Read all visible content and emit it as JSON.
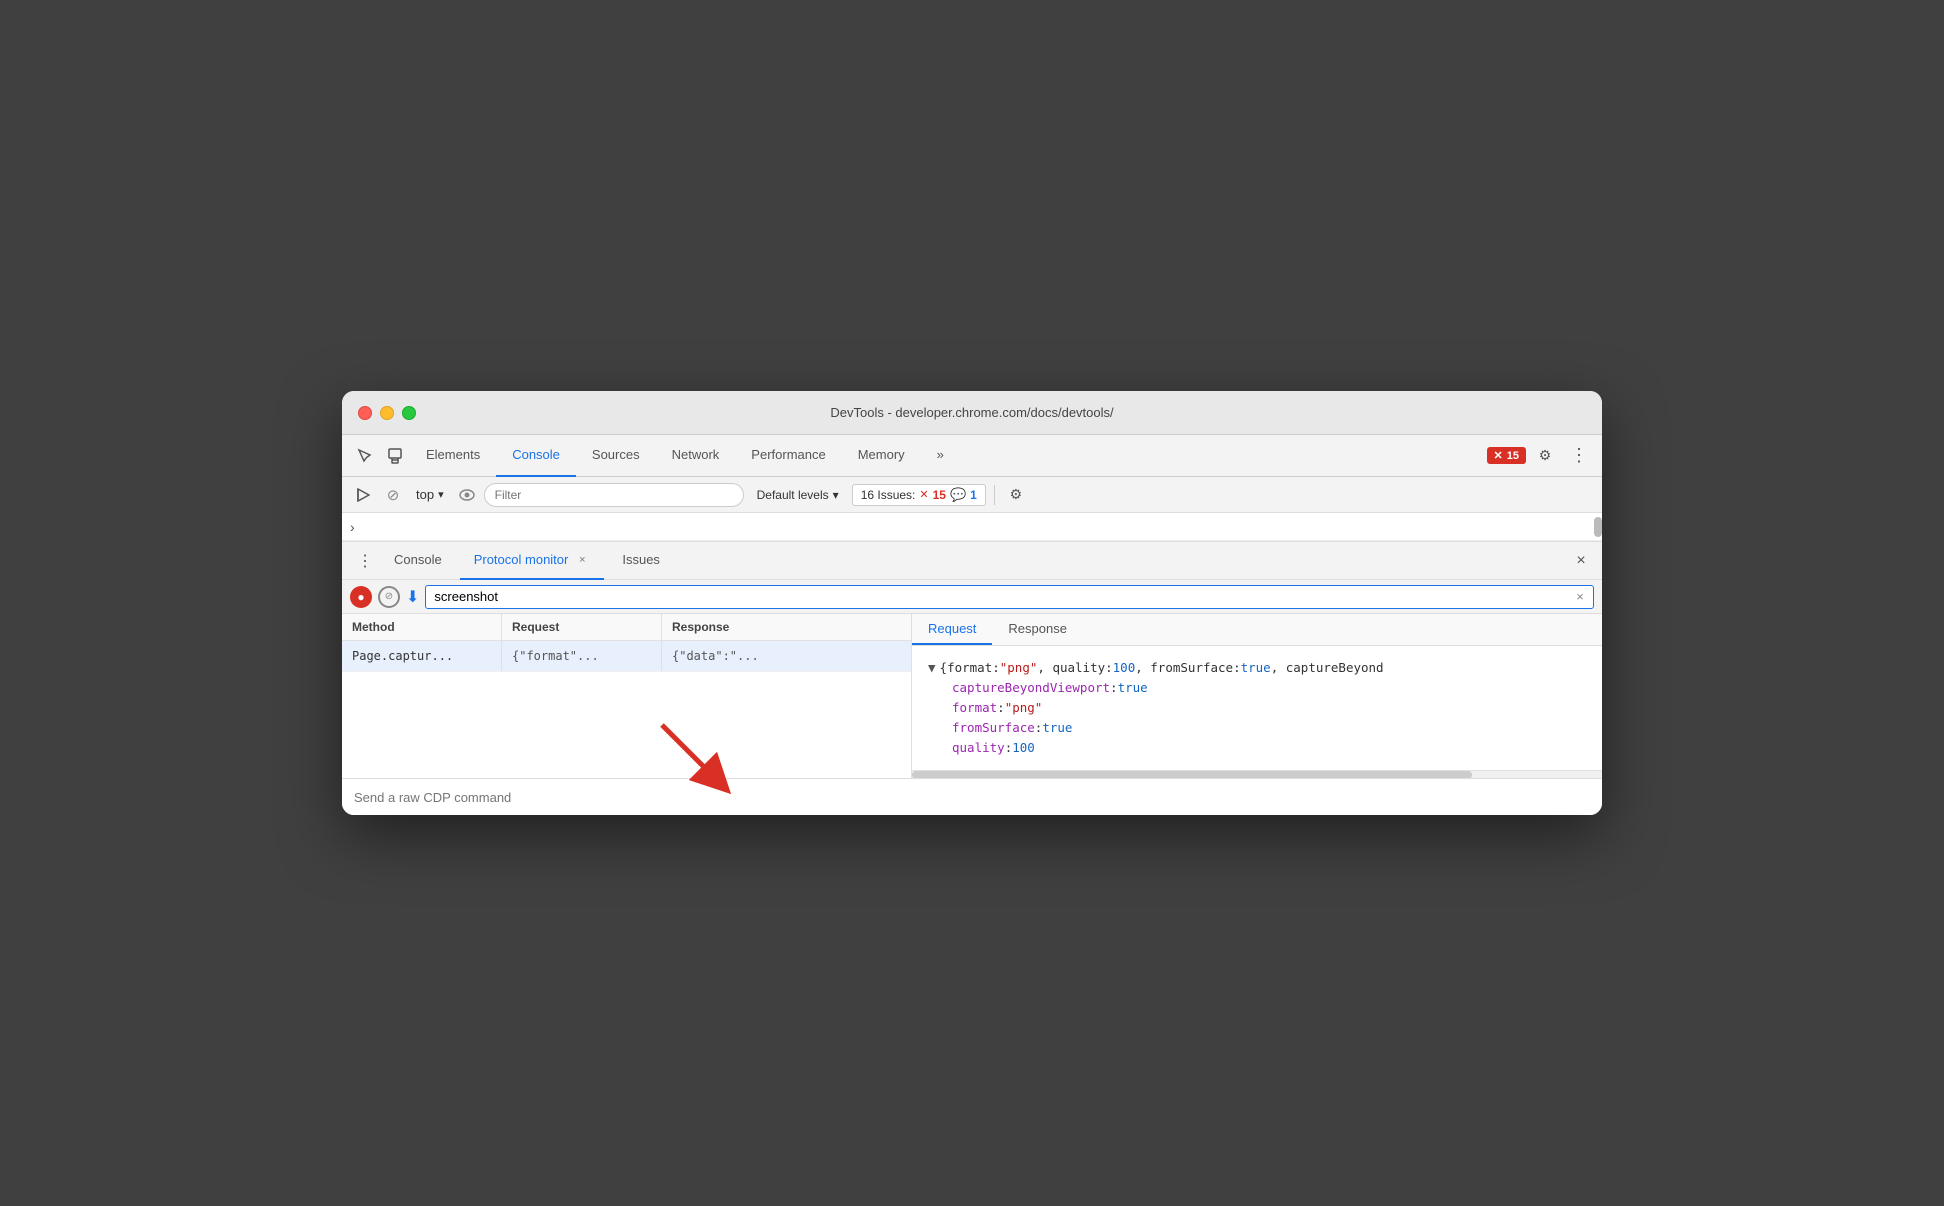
{
  "window": {
    "title": "DevTools - developer.chrome.com/docs/devtools/"
  },
  "tabs": {
    "elements": "Elements",
    "console": "Console",
    "sources": "Sources",
    "network": "Network",
    "performance": "Performance",
    "memory": "Memory",
    "more": "»"
  },
  "error_badge": {
    "icon": "✕",
    "count": "15"
  },
  "toolbar": {
    "top_label": "top",
    "filter_placeholder": "Filter",
    "default_levels": "Default levels",
    "issues_label": "16 Issues:",
    "issues_errors": "15",
    "issues_info": "1"
  },
  "bottom_tabs": {
    "console": "Console",
    "protocol_monitor": "Protocol monitor",
    "issues": "Issues"
  },
  "protocol_monitor": {
    "search_value": "screenshot",
    "table_headers": {
      "method": "Method",
      "request": "Request",
      "response": "Response"
    },
    "rows": [
      {
        "method": "Page.captur...",
        "request": "{\"format\"...",
        "response": "{\"data\":\"..."
      }
    ],
    "right_tabs": {
      "request": "Request",
      "response": "Response"
    },
    "json_preview": {
      "summary": "{format: \"png\", quality: 100, fromSurface: true, captureBeyond",
      "lines": [
        {
          "key": "captureBeyondViewport",
          "colon": ":",
          "value": "true",
          "type": "bool"
        },
        {
          "key": "format",
          "colon": ":",
          "value": "\"png\"",
          "type": "string"
        },
        {
          "key": "fromSurface",
          "colon": ":",
          "value": "true",
          "type": "bool"
        },
        {
          "key": "quality",
          "colon": ":",
          "value": "100",
          "type": "num"
        }
      ]
    }
  },
  "bottom_input": {
    "placeholder": "Send a raw CDP command"
  },
  "icons": {
    "cursor": "⬆",
    "device": "⬜",
    "play": "▶",
    "ban": "⊘",
    "eye": "👁",
    "chevron_down": "▾",
    "more_vert": "⋮",
    "gear": "⚙",
    "close": "×",
    "record": "●",
    "download": "⬇",
    "three_dot": "⋮",
    "collapse": "▼"
  },
  "colors": {
    "accent": "#1a73e8",
    "error": "#d93025",
    "purple": "#9c27b0",
    "dark_red": "#b71c1c",
    "blue_value": "#1565c0"
  }
}
